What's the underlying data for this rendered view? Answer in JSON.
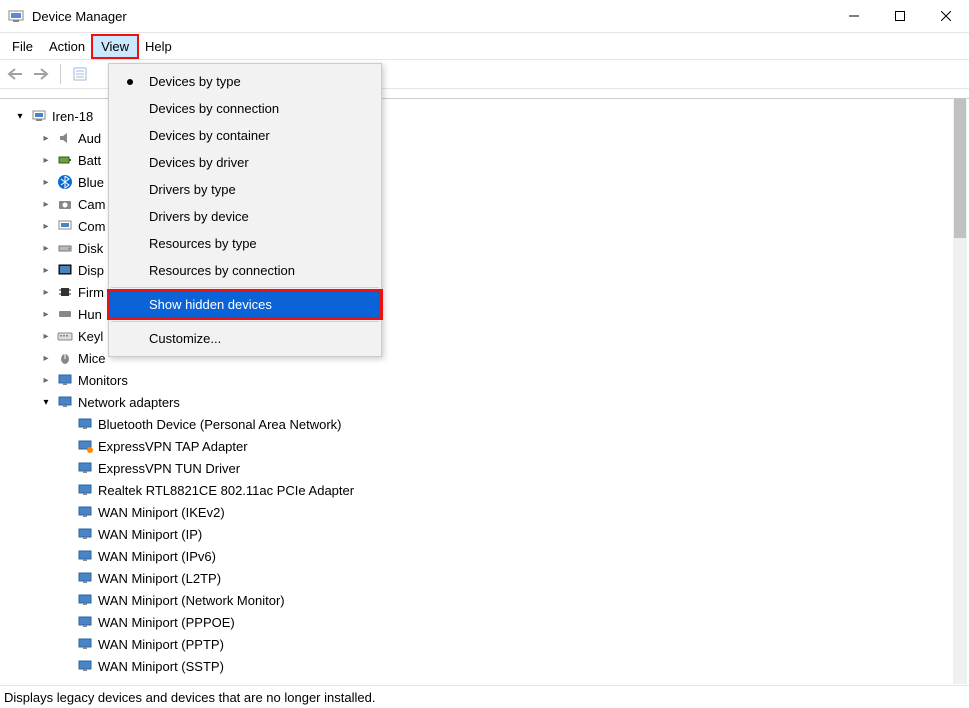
{
  "window": {
    "title": "Device Manager"
  },
  "menubar": {
    "file": "File",
    "action": "Action",
    "view": "View",
    "help": "Help"
  },
  "dropdown": {
    "devices_by_type": "Devices by type",
    "devices_by_connection": "Devices by connection",
    "devices_by_container": "Devices by container",
    "devices_by_driver": "Devices by driver",
    "drivers_by_type": "Drivers by type",
    "drivers_by_device": "Drivers by device",
    "resources_by_type": "Resources by type",
    "resources_by_connection": "Resources by connection",
    "show_hidden_devices": "Show hidden devices",
    "customize": "Customize..."
  },
  "tree": {
    "root": "Iren-18",
    "audio": "Aud",
    "batteries": "Batt",
    "bluetooth": "Blue",
    "cameras": "Cam",
    "computer": "Com",
    "disk": "Disk",
    "display": "Disp",
    "firmware": "Firm",
    "hid": "Hun",
    "keyboards": "Keyl",
    "mice": "Mice",
    "monitors": "Monitors",
    "network": "Network adapters",
    "net_items": {
      "bt_pan": "Bluetooth Device (Personal Area Network)",
      "express_tap": "ExpressVPN TAP Adapter",
      "express_tun": "ExpressVPN TUN Driver",
      "realtek": "Realtek RTL8821CE 802.11ac PCIe Adapter",
      "wan_ikev2": "WAN Miniport (IKEv2)",
      "wan_ip": "WAN Miniport (IP)",
      "wan_ipv6": "WAN Miniport (IPv6)",
      "wan_l2tp": "WAN Miniport (L2TP)",
      "wan_netmon": "WAN Miniport (Network Monitor)",
      "wan_pppoe": "WAN Miniport (PPPOE)",
      "wan_pptp": "WAN Miniport (PPTP)",
      "wan_sstp": "WAN Miniport (SSTP)"
    }
  },
  "statusbar": {
    "text": "Displays legacy devices and devices that are no longer installed."
  }
}
